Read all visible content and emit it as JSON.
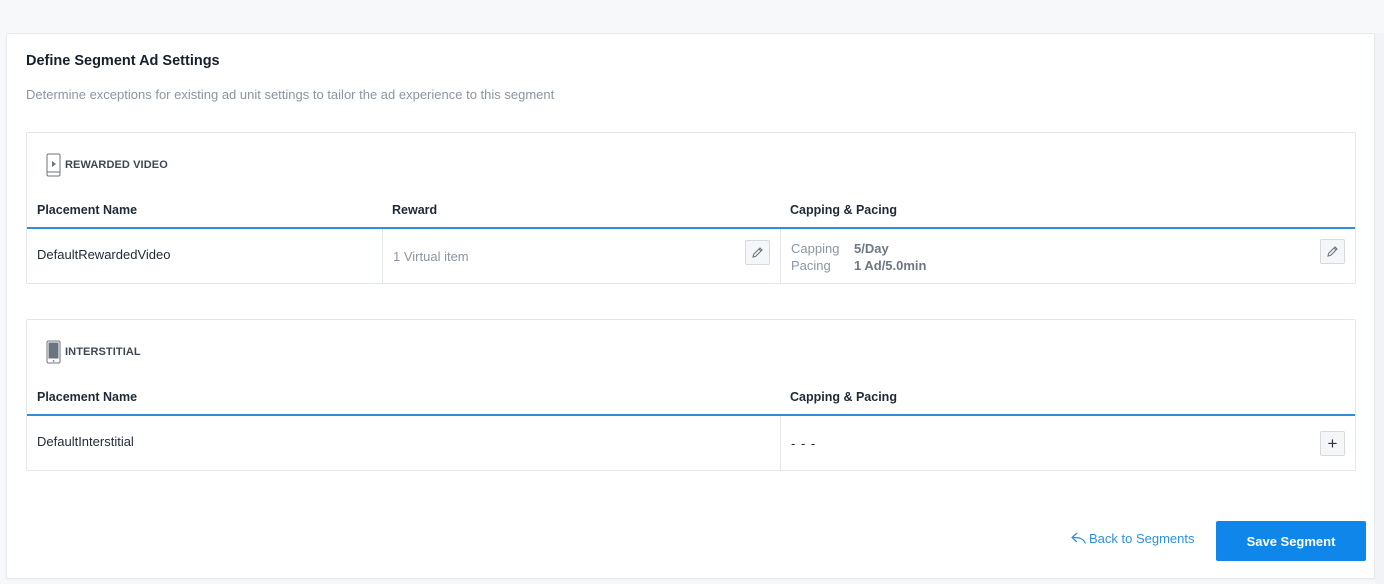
{
  "page": {
    "title": "Define Segment Ad Settings",
    "subtitle": "Determine exceptions for existing ad unit settings to tailor the ad experience to this segment"
  },
  "rewarded_video": {
    "label": "REWARDED VIDEO",
    "icon": "rewarded-video-phone-icon",
    "columns": [
      "Placement Name",
      "Reward",
      "Capping & Pacing"
    ],
    "rows": [
      {
        "placement": "DefaultRewardedVideo",
        "reward": "1 Virtual item",
        "capping_label": "Capping",
        "capping_value": "5/Day",
        "pacing_label": "Pacing",
        "pacing_value": "1 Ad/5.0min"
      }
    ]
  },
  "interstitial": {
    "label": "INTERSTITIAL",
    "icon": "interstitial-phone-icon",
    "columns": [
      "Placement Name",
      "Capping & Pacing"
    ],
    "rows": [
      {
        "placement": "DefaultInterstitial",
        "capping_pacing": "- - -",
        "add_label": "+"
      }
    ]
  },
  "footer": {
    "back_label": "Back to Segments",
    "save_label": "Save Segment"
  },
  "colors": {
    "accent": "#0f87ea",
    "header_line": "#2f8fdb",
    "muted_text": "#8a96a3"
  }
}
